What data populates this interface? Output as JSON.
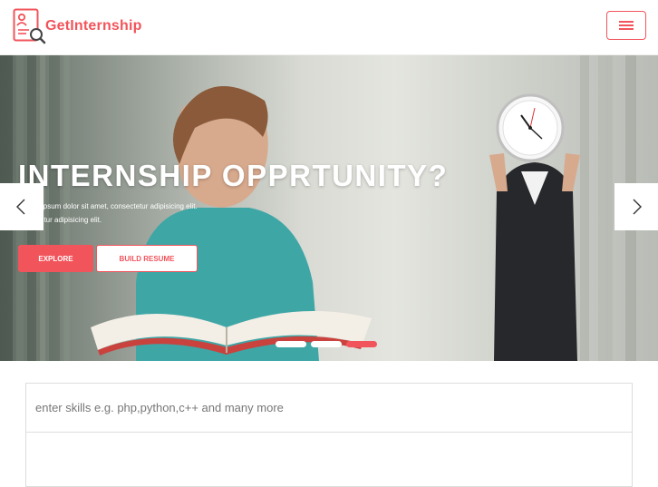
{
  "brand": {
    "name": "GetInternship",
    "logo_icon": "resume-search-icon",
    "accent_color": "#f2545b"
  },
  "nav": {
    "menu_icon": "hamburger-menu-icon"
  },
  "hero": {
    "title": "INTERNSHIP OPPRTUNITY?",
    "line1": "ipsum dolor sit amet, consectetur adipisicing elit.",
    "line2": "etur adipisicing elit.",
    "primary_button": "EXPLORE",
    "secondary_button": "BUILD RESUME",
    "prev_icon": "chevron-left-icon",
    "next_icon": "chevron-right-icon",
    "slide_count": 3,
    "active_slide": 3
  },
  "search": {
    "placeholder": "enter skills e.g. php,python,c++ and many more",
    "value": ""
  }
}
